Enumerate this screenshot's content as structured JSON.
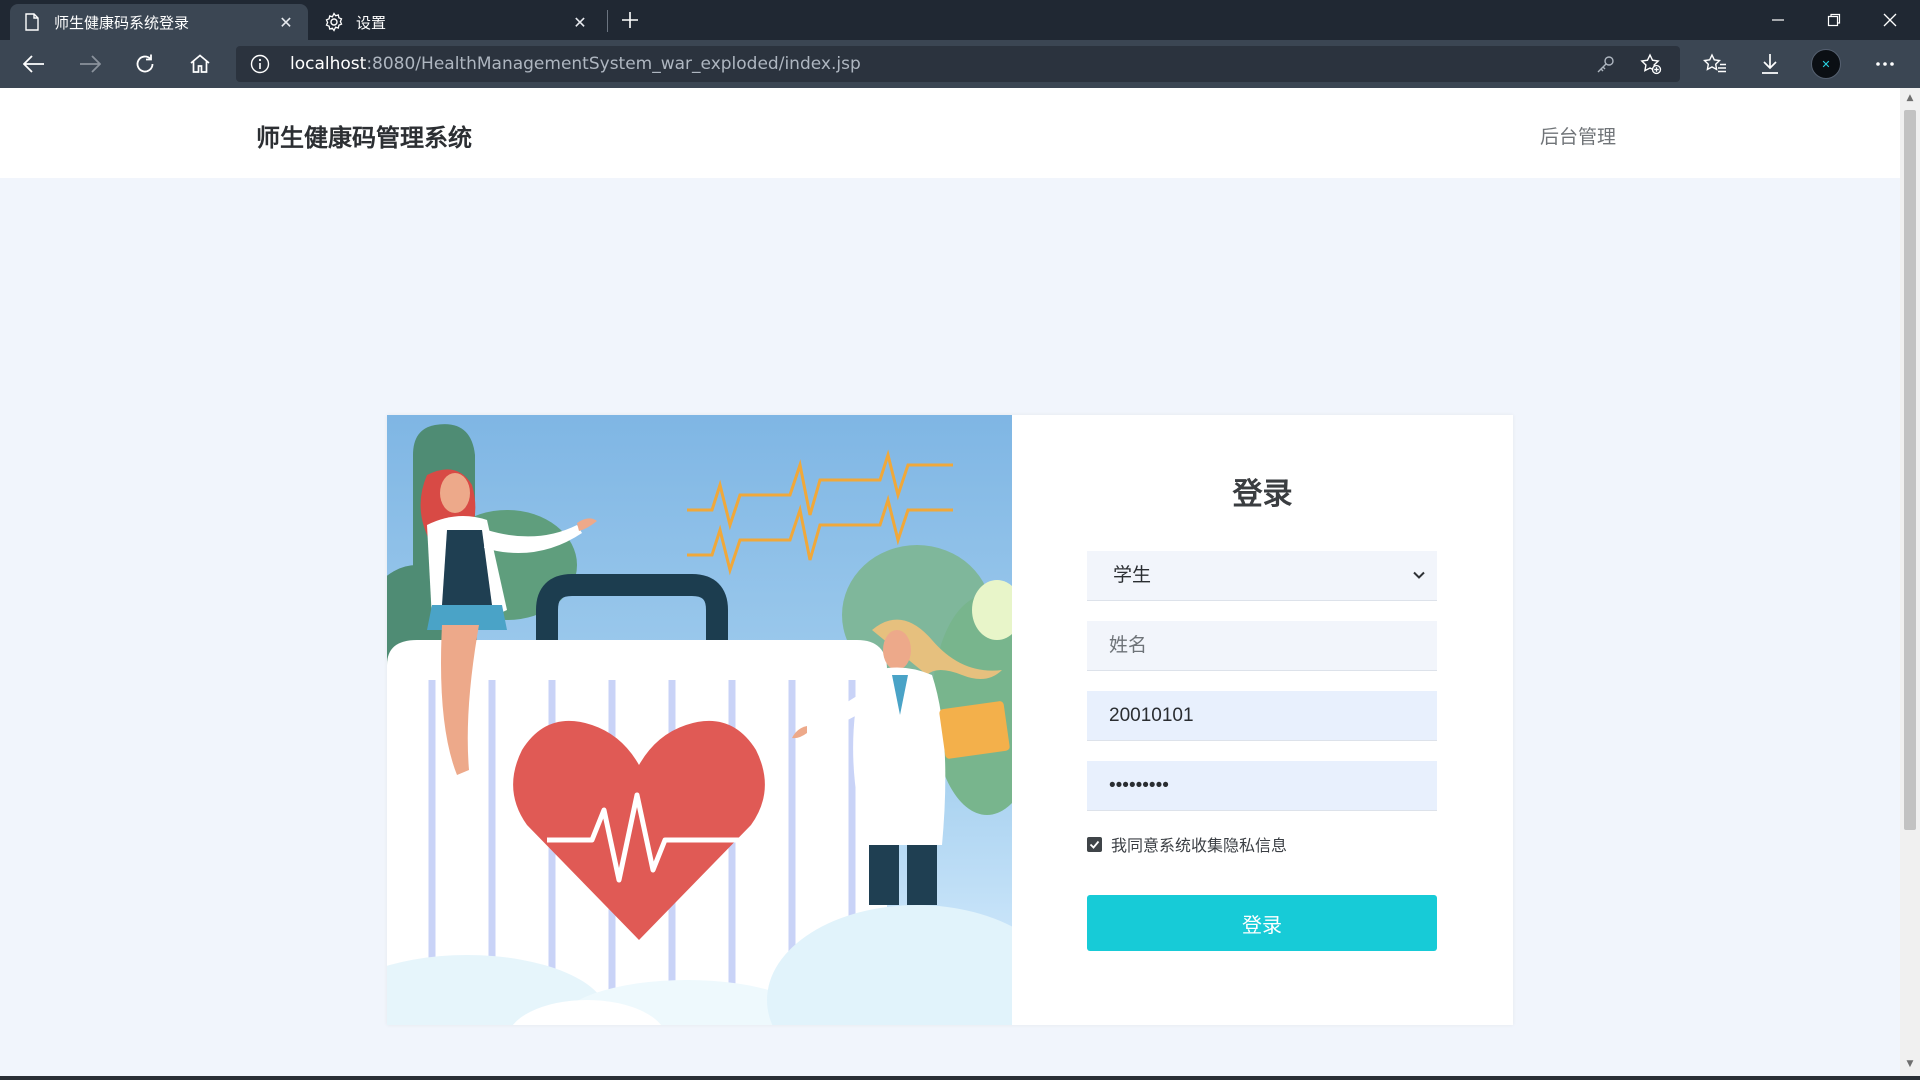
{
  "browser": {
    "tabs": [
      {
        "title": "师生健康码系统登录",
        "active": true
      },
      {
        "title": "设置",
        "active": false
      }
    ],
    "address": {
      "host": "localhost",
      "rest": ":8080/HealthManagementSystem_war_exploded/index.jsp"
    }
  },
  "header": {
    "brand": "师生健康码管理系统",
    "admin_link": "后台管理"
  },
  "login": {
    "title": "登录",
    "role_selected": "学生",
    "name_placeholder": "姓名",
    "id_value": "20010101",
    "password_value": "123456789",
    "agree_checked": true,
    "agree_label": "我同意系统收集隐私信息",
    "submit_label": "登录"
  },
  "colors": {
    "accent": "#17cbd7",
    "page_bg": "#f1f5fc",
    "chrome_dark": "#202833",
    "chrome_toolbar": "#3b4653"
  }
}
